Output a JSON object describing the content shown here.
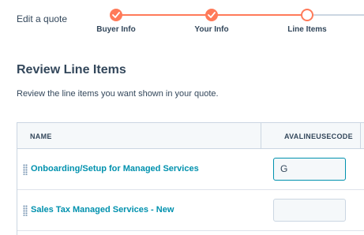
{
  "header": {
    "title": "Edit a quote"
  },
  "stepper": {
    "steps": [
      {
        "label": "Buyer Info",
        "status": "complete"
      },
      {
        "label": "Your Info",
        "status": "complete"
      },
      {
        "label": "Line Items",
        "status": "current"
      }
    ],
    "accent_color": "#ff7a59"
  },
  "section": {
    "title": "Review Line Items",
    "description": "Review the line items you want shown in your quote."
  },
  "table": {
    "columns": [
      "NAME",
      "AVALINEUSECODE"
    ],
    "rows": [
      {
        "name": "Onboarding/Setup for Managed Services",
        "code": "G"
      },
      {
        "name": "Sales Tax Managed Services - New",
        "code": ""
      }
    ]
  }
}
